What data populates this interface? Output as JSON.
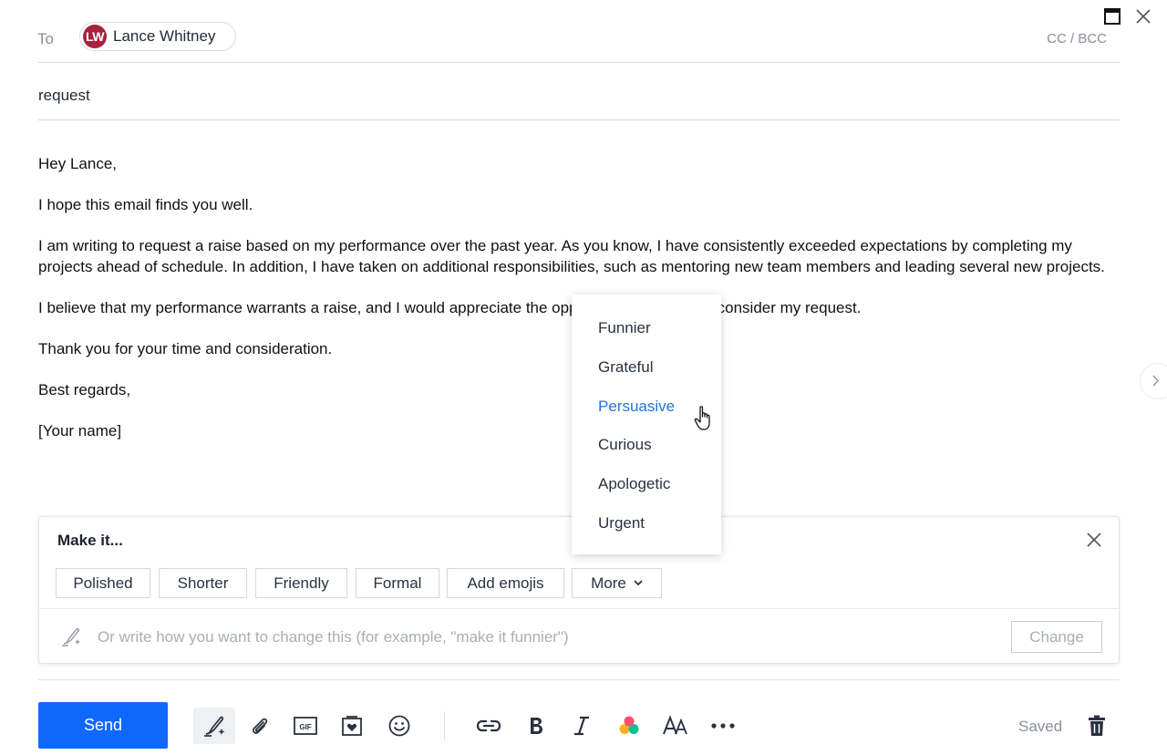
{
  "header": {
    "to_label": "To",
    "recipient": {
      "initials": "LW",
      "name": "Lance Whitney"
    },
    "cc_bcc": "CC / BCC",
    "subject": "request"
  },
  "body": {
    "paragraphs": [
      "Hey Lance,",
      "I hope this email finds you well.",
      "I am writing to request a raise based on my performance over the past year. As you know, I have consistently exceeded expectations by completing my projects ahead of schedule. In addition, I have taken on additional responsibilities, such as mentoring new team members and leading several new projects.",
      "I believe that my performance warrants a raise, and I would appreciate the opportunity to have you consider my request.",
      "Thank you for your time and consideration.",
      "Best regards,",
      "[Your name]"
    ]
  },
  "make_it": {
    "title": "Make it...",
    "chips": [
      "Polished",
      "Shorter",
      "Friendly",
      "Formal",
      "Add emojis",
      "More"
    ],
    "input_placeholder": "Or write how you want to change this (for example, \"make it funnier\")",
    "change_label": "Change"
  },
  "more_menu": {
    "items": [
      "Funnier",
      "Grateful",
      "Persuasive",
      "Curious",
      "Apologetic",
      "Urgent"
    ],
    "hovered": "Persuasive"
  },
  "footer": {
    "send_label": "Send",
    "saved_label": "Saved",
    "gif_label": "GIF",
    "tools": [
      "writing-assistant-icon",
      "attachment-icon",
      "gif-icon",
      "stationery-icon",
      "emoji-icon",
      "link-icon",
      "bold-icon",
      "italic-icon",
      "color-icon",
      "font-size-icon",
      "more-options-icon"
    ]
  },
  "colors": {
    "accent": "#0f69ff",
    "menu_active": "#2173d9",
    "avatar": "#a8223f"
  }
}
